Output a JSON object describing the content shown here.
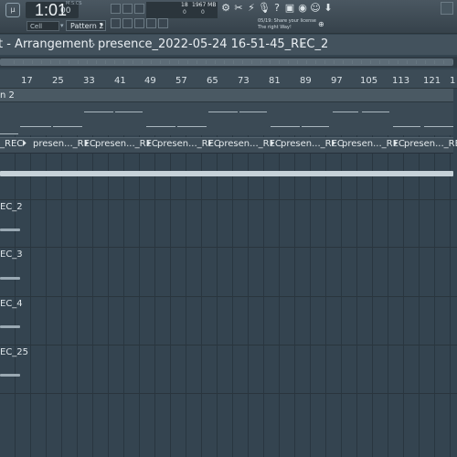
{
  "toolbar": {
    "loop_label": "µ",
    "time_main": "1:01",
    "time_sub": "00",
    "time_tag": "M:S:CS",
    "snap_label": "Cell",
    "pattern_label": "Pattern 2",
    "tempo_value": "18",
    "memory_value": "1967 MB",
    "memory_zero": "0",
    "memory_b": "0",
    "news_line1": "05/19: Share your license",
    "news_line2": "The right Way!",
    "icon_names": [
      "cpu-icon",
      "scissors-icon",
      "plug-icon",
      "mic-icon",
      "help-icon",
      "save-icon",
      "rec-icon",
      "chat-icon",
      "download-icon"
    ]
  },
  "window": {
    "title": "t - Arrangement",
    "file_name": "presence_2022-05-24 16-51-45_REC_2"
  },
  "ruler": {
    "bars": [
      "17",
      "25",
      "33",
      "41",
      "49",
      "57",
      "65",
      "73",
      "81",
      "89",
      "97",
      "105",
      "113",
      "121",
      "1"
    ]
  },
  "track": {
    "header_label": "n 2",
    "clip_first": "_REC",
    "clip_label": "presen..._REC",
    "clip_partial": "prese"
  },
  "side_labels": [
    "EC_2",
    "EC_3",
    "EC_4",
    "EC_25"
  ]
}
